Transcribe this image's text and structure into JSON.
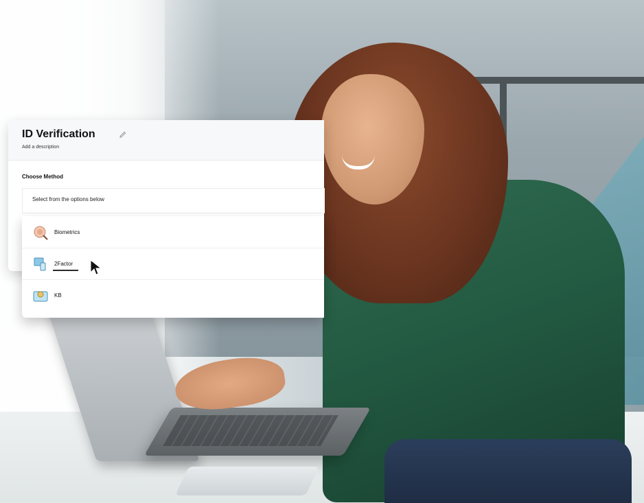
{
  "panel": {
    "title": "ID Verification",
    "description": "Add a description",
    "choose_label": "Choose Method",
    "select_placeholder": "Select from the options below",
    "edit_icon": "pencil-icon"
  },
  "options": [
    {
      "label": "Biometrics",
      "icon": "biometrics-icon"
    },
    {
      "label": "2Factor",
      "icon": "two-factor-icon"
    },
    {
      "label": "KB",
      "icon": "kba-icon"
    }
  ],
  "colors": {
    "sweater": "#235a42",
    "hair": "#6b3520",
    "panel_bg": "#ffffff",
    "accent_teal": "#4f9db2"
  }
}
